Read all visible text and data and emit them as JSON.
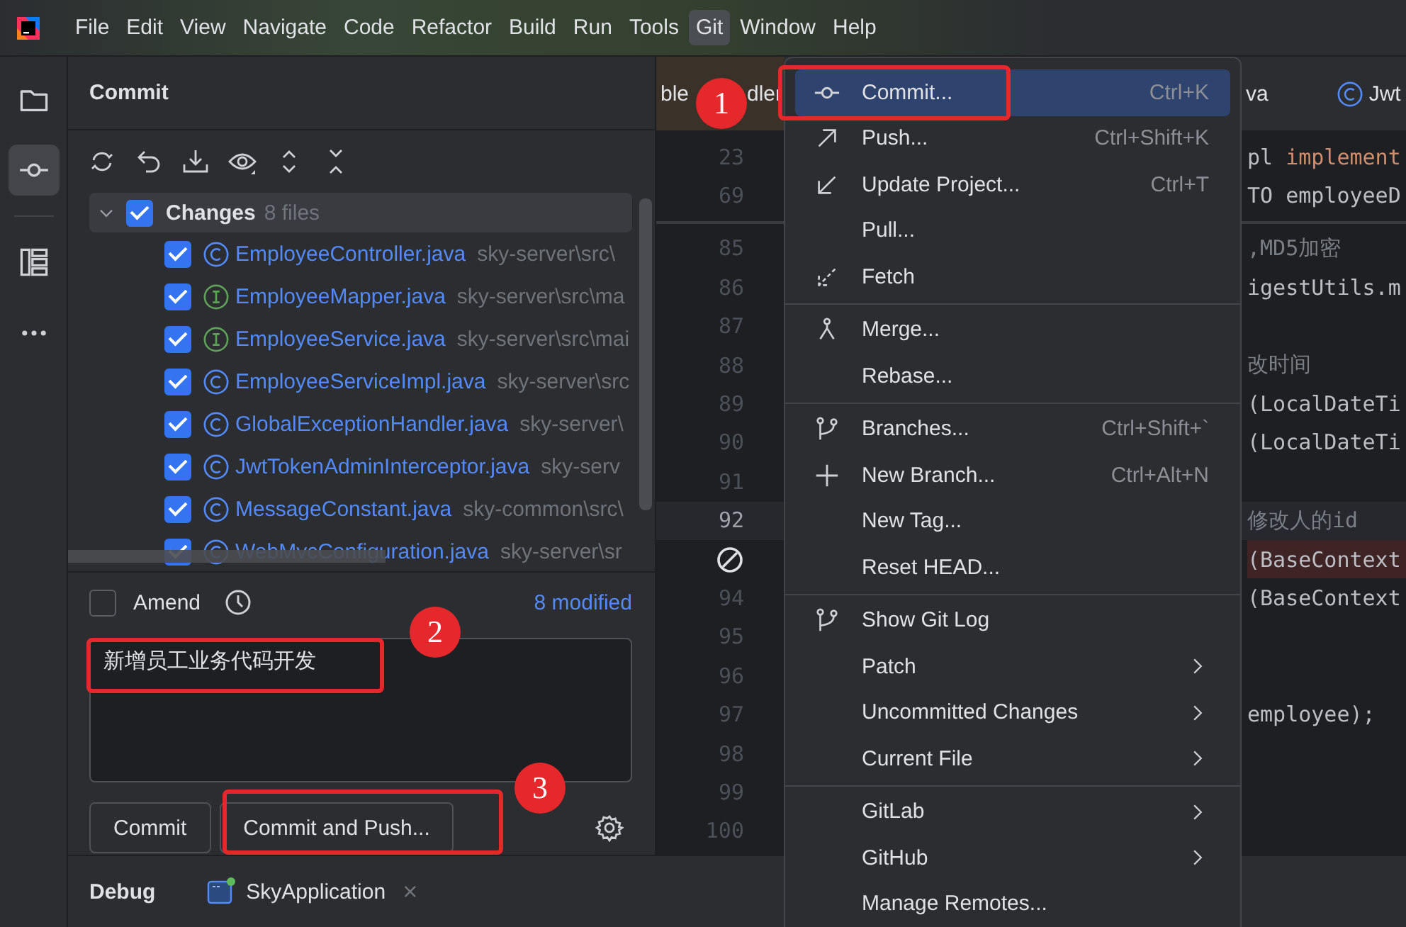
{
  "menubar": {
    "items": [
      {
        "label": "File",
        "selected": false
      },
      {
        "label": "Edit",
        "selected": false
      },
      {
        "label": "View",
        "selected": false
      },
      {
        "label": "Navigate",
        "selected": false
      },
      {
        "label": "Code",
        "selected": false
      },
      {
        "label": "Refactor",
        "selected": false
      },
      {
        "label": "Build",
        "selected": false
      },
      {
        "label": "Run",
        "selected": false
      },
      {
        "label": "Tools",
        "selected": false
      },
      {
        "label": "Git",
        "selected": true
      },
      {
        "label": "Window",
        "selected": false
      },
      {
        "label": "Help",
        "selected": false
      }
    ]
  },
  "tool_strip": {
    "items": [
      {
        "selected": false
      },
      {
        "selected": true
      },
      {
        "selected": false
      },
      {
        "selected": false
      }
    ]
  },
  "commit_panel": {
    "title": "Commit",
    "changes": {
      "label": "Changes",
      "count": "8 files",
      "checked": true,
      "expanded": true,
      "files": [
        {
          "name": "EmployeeController.java",
          "path": "sky-server\\src\\",
          "kind": "class",
          "checked": true
        },
        {
          "name": "EmployeeMapper.java",
          "path": "sky-server\\src\\ma",
          "kind": "interface",
          "checked": true
        },
        {
          "name": "EmployeeService.java",
          "path": "sky-server\\src\\mai",
          "kind": "interface",
          "checked": true
        },
        {
          "name": "EmployeeServiceImpl.java",
          "path": "sky-server\\src",
          "kind": "class",
          "checked": true
        },
        {
          "name": "GlobalExceptionHandler.java",
          "path": "sky-server\\",
          "kind": "class",
          "checked": true
        },
        {
          "name": "JwtTokenAdminInterceptor.java",
          "path": "sky-serv",
          "kind": "class",
          "checked": true
        },
        {
          "name": "MessageConstant.java",
          "path": "sky-common\\src\\",
          "kind": "class",
          "checked": true
        },
        {
          "name": "WebMvcConfiguration.java",
          "path": "sky-server\\sr",
          "kind": "class",
          "checked": true
        }
      ]
    },
    "amend": {
      "label": "Amend",
      "checked": false
    },
    "modified_link": "8 modified",
    "message": {
      "value": "新增员工业务代码开发"
    },
    "buttons": [
      "Commit",
      "Commit and Push..."
    ]
  },
  "bottom_bar": {
    "tab": "Debug",
    "run_config": "SkyApplication",
    "close": "×"
  },
  "editor": {
    "tabs": [
      {
        "label_parts": [
          "ble",
          "dler"
        ],
        "kind": "plain"
      },
      {
        "label": "va",
        "kind": "plain"
      },
      {
        "label": "Jwt",
        "kind": "class"
      }
    ],
    "sticky_lines": [
      {
        "number": "23",
        "segments": [
          {
            "text": "pl ",
            "kind": "plain"
          },
          {
            "text": "implement",
            "kind": "keyword"
          }
        ]
      },
      {
        "number": "69",
        "segments": [
          {
            "text": "TO employeeD",
            "kind": "plain"
          }
        ]
      }
    ],
    "lines": [
      {
        "number": "85",
        "kind": "normal",
        "segments": [
          {
            "text": ",MD5加密",
            "kind": "comment"
          }
        ]
      },
      {
        "number": "86",
        "kind": "normal",
        "segments": [
          {
            "text": "igestUtils.m",
            "kind": "plain"
          }
        ]
      },
      {
        "number": "87",
        "kind": "normal"
      },
      {
        "number": "88",
        "kind": "normal",
        "segments": [
          {
            "text": "改时间",
            "kind": "comment"
          }
        ]
      },
      {
        "number": "89",
        "kind": "normal",
        "segments": [
          {
            "text": "(LocalDateTi",
            "kind": "plain"
          }
        ]
      },
      {
        "number": "90",
        "kind": "normal",
        "segments": [
          {
            "text": "(LocalDateTi",
            "kind": "plain"
          }
        ]
      },
      {
        "number": "91",
        "kind": "normal"
      },
      {
        "number": "92",
        "kind": "current",
        "segments": [
          {
            "text": "修改人的id",
            "kind": "comment"
          }
        ]
      },
      {
        "kind": "breakpoint",
        "segments": [
          {
            "text": "(BaseContext",
            "kind": "plain"
          }
        ]
      },
      {
        "number": "94",
        "kind": "normal",
        "segments": [
          {
            "text": "(BaseContext",
            "kind": "plain"
          }
        ]
      },
      {
        "number": "95",
        "kind": "normal"
      },
      {
        "number": "96",
        "kind": "normal"
      },
      {
        "number": "97",
        "kind": "normal",
        "segments": [
          {
            "text": "employee);",
            "kind": "plain"
          }
        ]
      },
      {
        "number": "98",
        "kind": "normal"
      },
      {
        "number": "99",
        "kind": "normal"
      },
      {
        "number": "100",
        "kind": "normal"
      }
    ]
  },
  "git_menu": {
    "groups": [
      [
        {
          "label": "Commit...",
          "shortcut": "Ctrl+K",
          "selected": true
        },
        {
          "label": "Push...",
          "shortcut": "Ctrl+Shift+K",
          "selected": false
        },
        {
          "label": "Update Project...",
          "shortcut": "Ctrl+T",
          "selected": false
        },
        {
          "label": "Pull...",
          "selected": false
        },
        {
          "label": "Fetch",
          "selected": false
        }
      ],
      [
        {
          "label": "Merge...",
          "selected": false
        },
        {
          "label": "Rebase...",
          "selected": false
        }
      ],
      [
        {
          "label": "Branches...",
          "shortcut": "Ctrl+Shift+`",
          "selected": false
        },
        {
          "label": "New Branch...",
          "shortcut": "Ctrl+Alt+N",
          "selected": false
        },
        {
          "label": "New Tag...",
          "selected": false
        },
        {
          "label": "Reset HEAD...",
          "selected": false
        }
      ],
      [
        {
          "label": "Show Git Log",
          "selected": false
        },
        {
          "label": "Patch",
          "submenu": true,
          "selected": false
        },
        {
          "label": "Uncommitted Changes",
          "submenu": true,
          "selected": false
        },
        {
          "label": "Current File",
          "submenu": true,
          "selected": false
        }
      ],
      [
        {
          "label": "GitLab",
          "submenu": true,
          "selected": false
        },
        {
          "label": "GitHub",
          "submenu": true,
          "selected": false
        },
        {
          "label": "Manage Remotes...",
          "selected": false
        }
      ]
    ]
  },
  "annotations": [
    {
      "number": "1"
    },
    {
      "number": "2"
    },
    {
      "number": "3"
    }
  ]
}
